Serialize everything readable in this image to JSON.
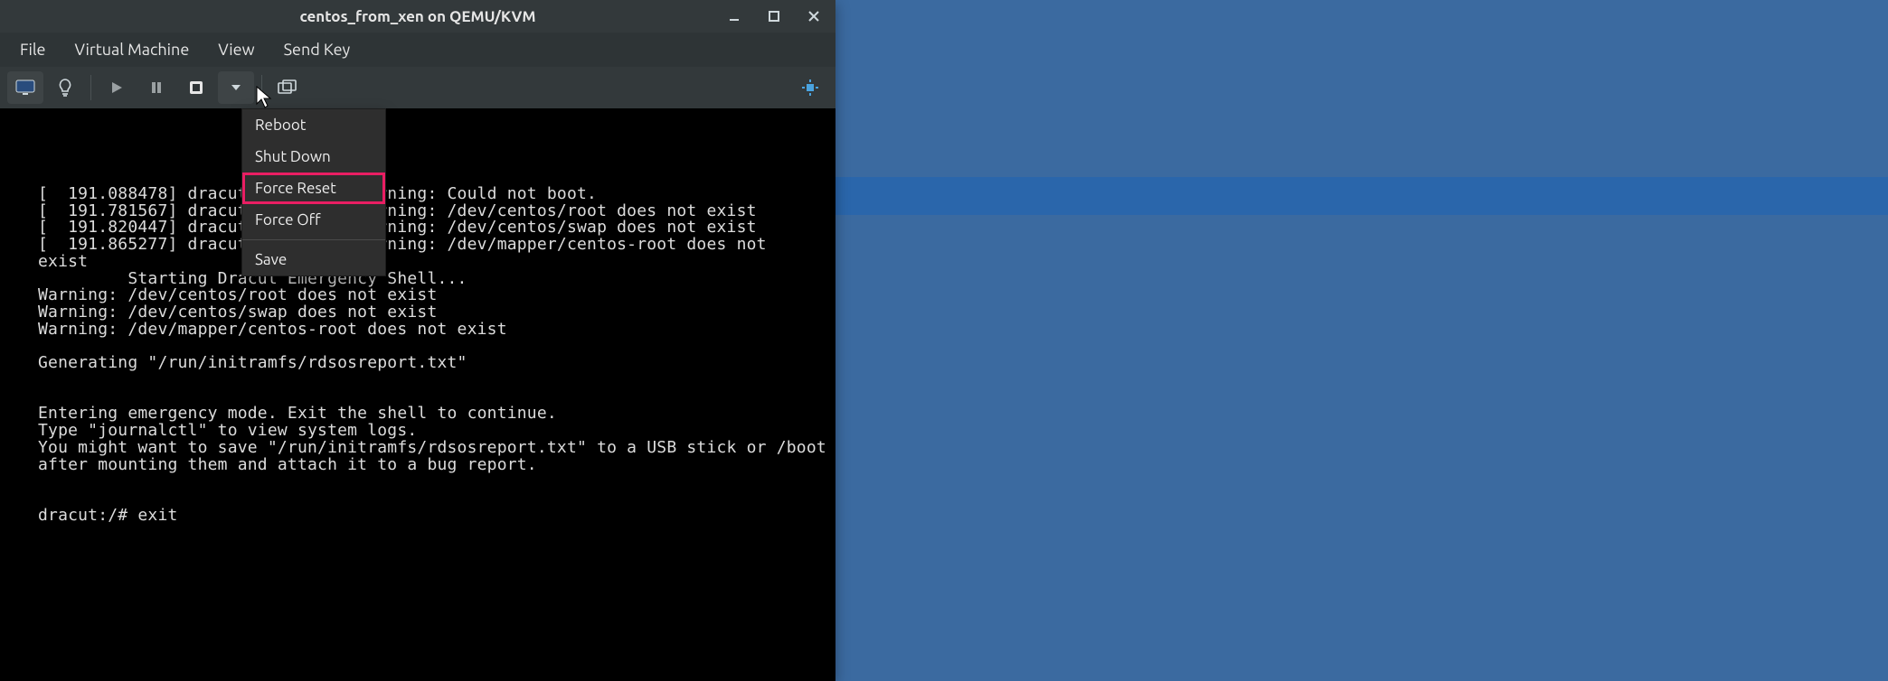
{
  "titlebar": {
    "title": "centos_from_xen on QEMU/KVM"
  },
  "menubar": {
    "items": [
      {
        "label": "File"
      },
      {
        "label": "Virtual Machine"
      },
      {
        "label": "View"
      },
      {
        "label": "Send Key"
      }
    ]
  },
  "dropdown": {
    "items": [
      {
        "label": "Reboot",
        "highlight": false
      },
      {
        "label": "Shut Down",
        "highlight": false
      },
      {
        "label": "Force Reset",
        "highlight": true
      },
      {
        "label": "Force Off",
        "highlight": false
      },
      {
        "label": "Save",
        "highlight": false,
        "separator_before": true
      }
    ]
  },
  "console": {
    "lines": [
      "[  191.088478] dracut-          Warning: Could not boot.",
      "[  191.781567] dracut-          Warning: /dev/centos/root does not exist",
      "[  191.820447] dracut-          Warning: /dev/centos/swap does not exist",
      "[  191.865277] dracut-          Warning: /dev/mapper/centos-root does not ",
      "exist",
      "         Starting Dracut Emergency Shell...",
      "Warning: /dev/centos/root does not exist",
      "Warning: /dev/centos/swap does not exist",
      "Warning: /dev/mapper/centos-root does not exist",
      "",
      "Generating \"/run/initramfs/rdsosreport.txt\"",
      "",
      "",
      "Entering emergency mode. Exit the shell to continue.",
      "Type \"journalctl\" to view system logs.",
      "You might want to save \"/run/initramfs/rdsosreport.txt\" to a USB stick or /boot",
      "after mounting them and attach it to a bug report.",
      "",
      "",
      "dracut:/# exit"
    ]
  }
}
